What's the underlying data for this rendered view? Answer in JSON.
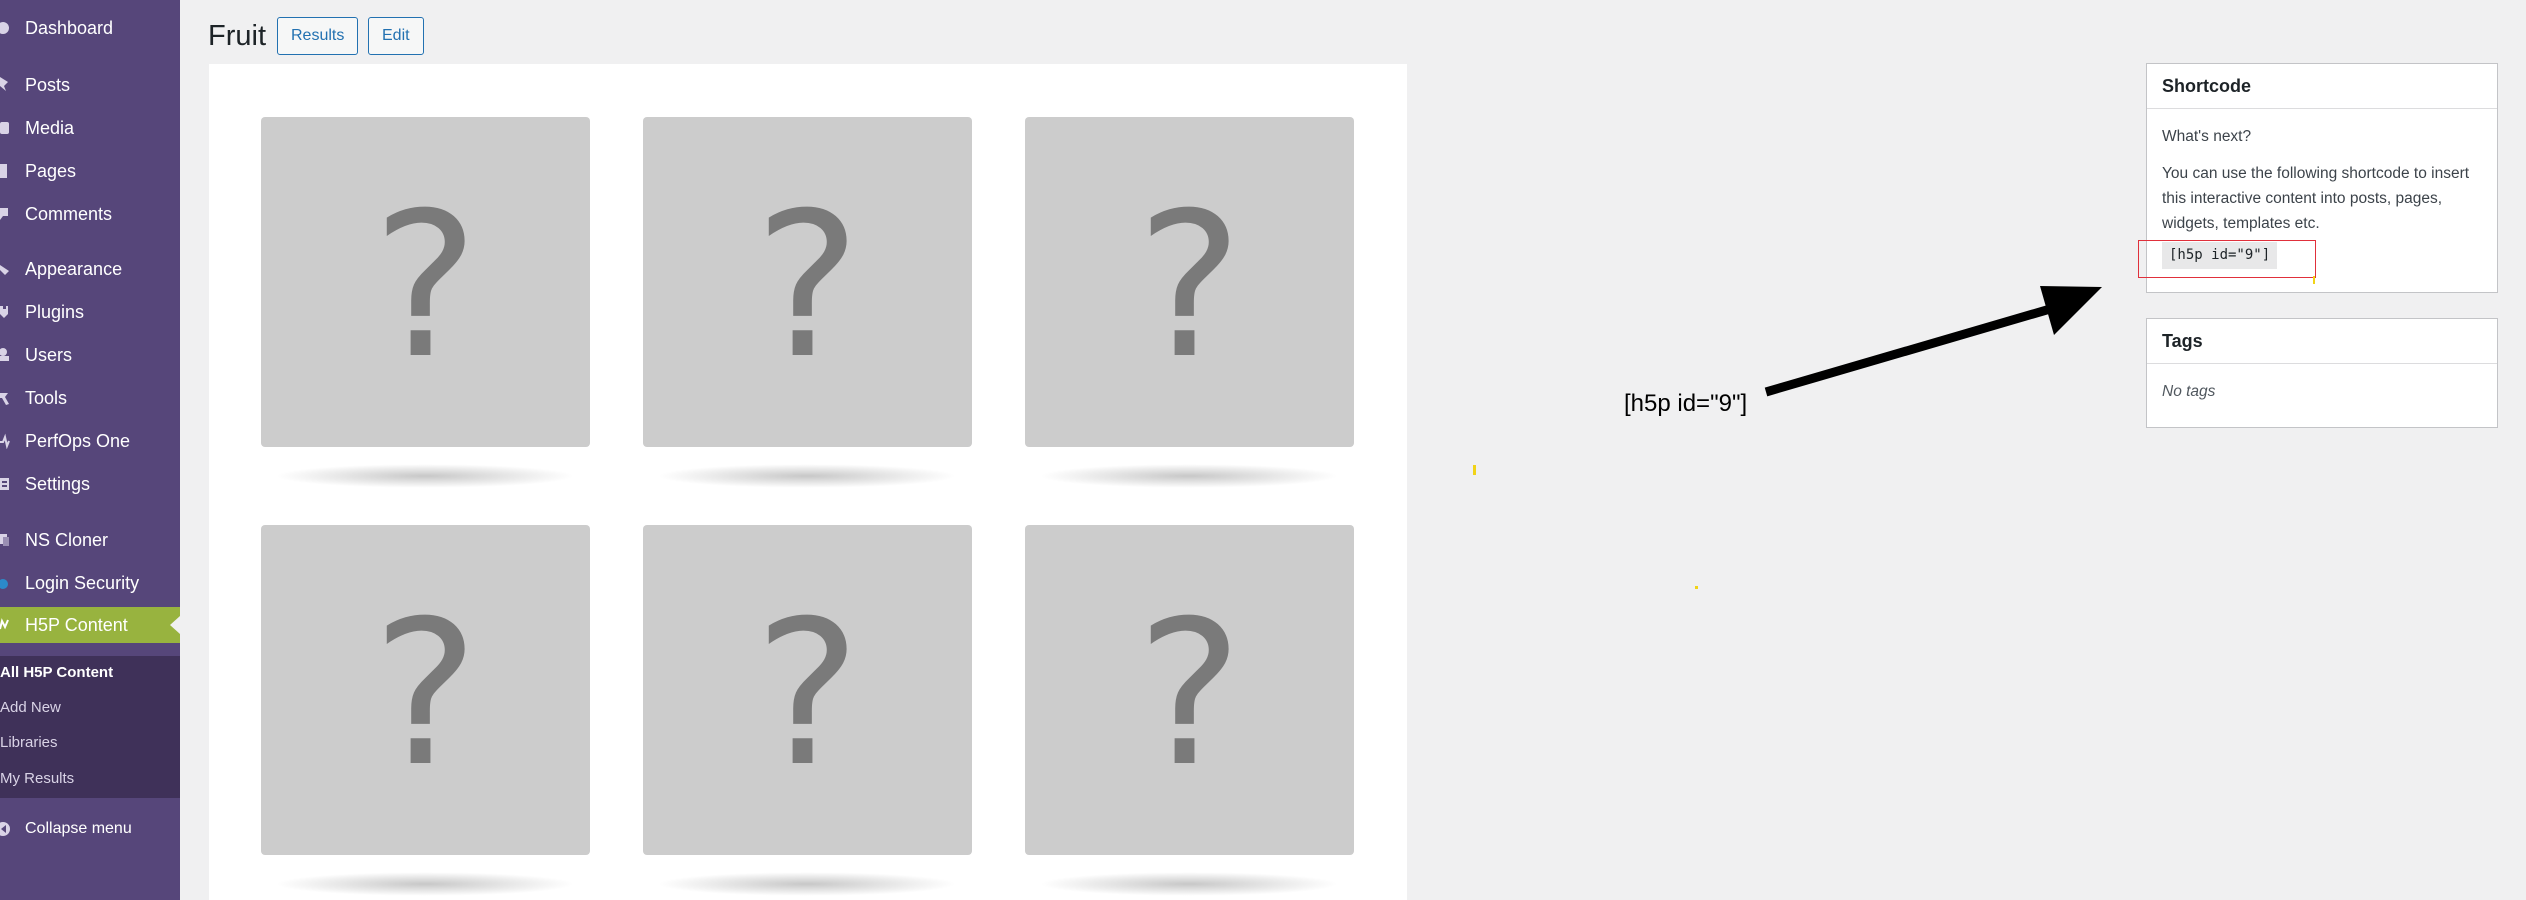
{
  "sidebar": {
    "items": [
      {
        "label": "Dashboard",
        "icon": "dashboard-icon"
      },
      {
        "label": "Posts",
        "icon": "pin-icon"
      },
      {
        "label": "Media",
        "icon": "media-icon"
      },
      {
        "label": "Pages",
        "icon": "page-icon"
      },
      {
        "label": "Comments",
        "icon": "comment-icon"
      },
      {
        "label": "Appearance",
        "icon": "brush-icon"
      },
      {
        "label": "Plugins",
        "icon": "plugin-icon"
      },
      {
        "label": "Users",
        "icon": "user-icon"
      },
      {
        "label": "Tools",
        "icon": "wrench-icon"
      },
      {
        "label": "PerfOps One",
        "icon": "pulse-icon"
      },
      {
        "label": "Settings",
        "icon": "settings-icon"
      },
      {
        "label": "NS Cloner",
        "icon": "cloner-icon"
      },
      {
        "label": "Login Security",
        "icon": "shield-icon"
      },
      {
        "label": "H5P Content",
        "icon": "h5p-icon"
      }
    ],
    "submenu": [
      "All H5P Content",
      "Add New",
      "Libraries",
      "My Results"
    ],
    "collapse_label": "Collapse menu",
    "colors": {
      "background": "#56467a",
      "active": "#98b33f",
      "submenu": "#3f3159"
    }
  },
  "header": {
    "title": "Fruit",
    "results_label": "Results",
    "edit_label": "Edit"
  },
  "content": {
    "card_glyph": "?",
    "card_count": 6
  },
  "shortcode_box": {
    "title": "Shortcode",
    "subheading": "What's next?",
    "description": "You can use the following shortcode to insert this interactive content into posts, pages, widgets, templates etc.",
    "code": "[h5p id=\"9\"]"
  },
  "tags_box": {
    "title": "Tags",
    "empty_text": "No tags"
  },
  "annotation": {
    "text": "[h5p id=\"9\"]",
    "highlight_color": "#e0303b"
  }
}
